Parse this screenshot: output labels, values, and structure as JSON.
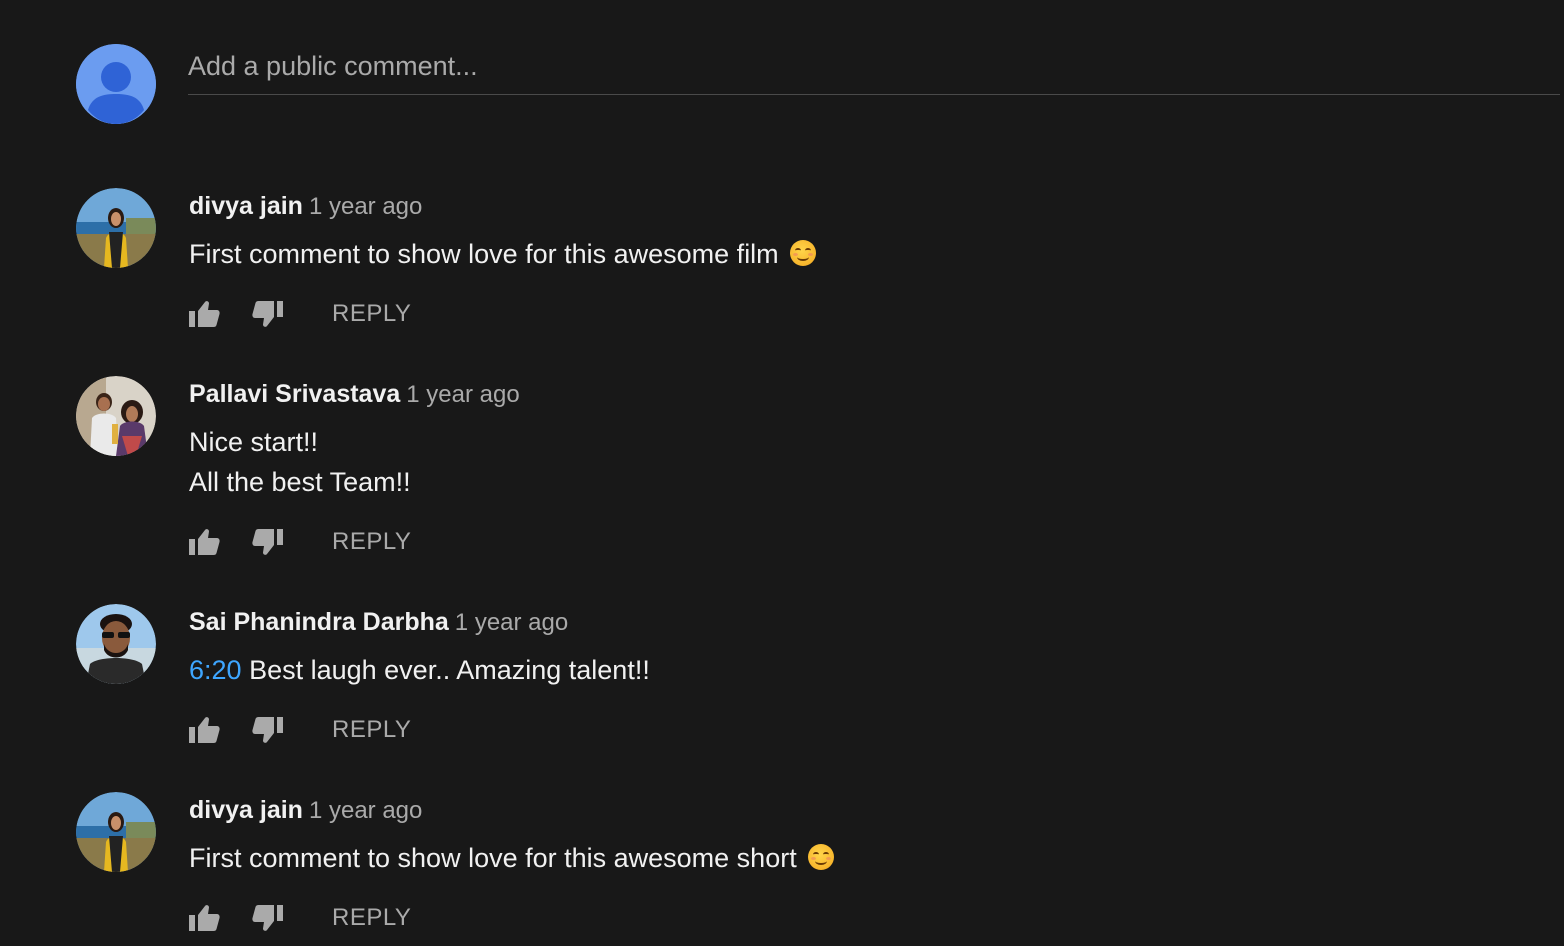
{
  "add_comment": {
    "placeholder": "Add a public comment..."
  },
  "colors": {
    "background": "#181818",
    "text": "#f1f1f1",
    "muted": "#aaaaaa",
    "link": "#3ea6ff",
    "default_avatar": "#6b9cf0"
  },
  "comments": [
    {
      "author": "divya jain",
      "time": "1 year ago",
      "lines": [
        "First comment to show love for this awesome film"
      ],
      "emoji": "smiling-face",
      "reply_label": "REPLY"
    },
    {
      "author": "Pallavi Srivastava",
      "time": "1 year ago",
      "lines": [
        "Nice start!!",
        "All the best Team!!"
      ],
      "reply_label": "REPLY"
    },
    {
      "author": "Sai Phanindra Darbha",
      "time": "1 year ago",
      "timestamp_link": "6:20",
      "lines": [
        "Best laugh ever.. Amazing talent!!"
      ],
      "reply_label": "REPLY"
    },
    {
      "author": "divya jain",
      "time": "1 year ago",
      "lines": [
        "First comment to show love for this awesome short"
      ],
      "emoji": "smiling-face",
      "reply_label": "REPLY"
    }
  ]
}
